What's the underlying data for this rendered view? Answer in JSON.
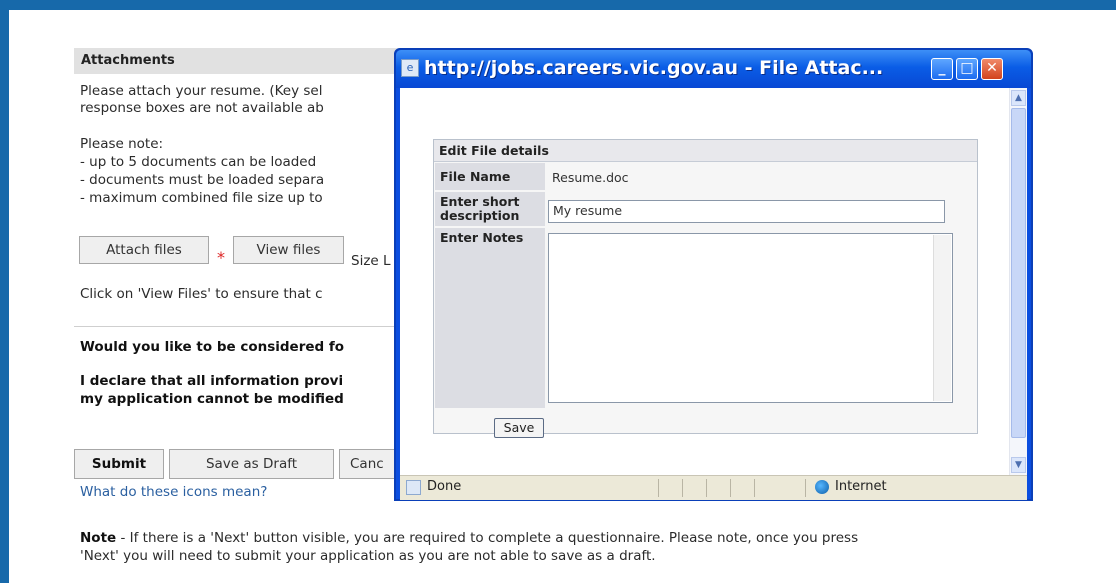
{
  "page": {
    "section_title": "Attachments",
    "intro_line1": "Please attach your resume. (Key sel",
    "intro_line2": "response boxes are not available ab",
    "note_heading": "Please note:",
    "note_item1": "- up to 5 documents can be loaded",
    "note_item2": "- documents must be loaded separa",
    "note_item3": "- maximum combined file size up to",
    "attach_btn": "Attach files",
    "required_star": "*",
    "view_btn": "View files",
    "size_text": "Size L",
    "click_line": "Click on 'View Files' to ensure that c",
    "consider_q": "Would you like to be considered fo",
    "declare_line1": "I declare that all information provi",
    "declare_line2": "my application cannot be modified",
    "submit_btn": "Submit",
    "save_draft_btn": "Save as Draft",
    "cancel_btn": "Canc",
    "icons_link": "What do these icons mean?",
    "footer_note_bold": "Note",
    "footer_note_line1": " - If there is a 'Next' button visible, you are required to complete a questionnaire. Please note, once you press",
    "footer_note_line2": "'Next' you will need to submit your application as you are not able to save as a draft."
  },
  "popup": {
    "title": "http://jobs.careers.vic.gov.au - File Attac...",
    "panel_title": "Edit File details",
    "file_name_label": "File Name",
    "file_name_value": "Resume.doc",
    "short_desc_label_line1": "Enter short",
    "short_desc_label_line2": "description",
    "short_desc_value": "My resume",
    "notes_label": "Enter Notes",
    "notes_value": "",
    "save_btn": "Save",
    "status_done": "Done",
    "status_zone": "Internet"
  },
  "icons": {
    "title_icon": "ie-page-icon",
    "minimize": "minimize-icon",
    "maximize": "maximize-icon",
    "close": "close-icon",
    "status_page": "page-icon",
    "status_zone": "globe-icon"
  },
  "colors": {
    "frame_blue": "#1769aa",
    "titlebar_blue": "#0a5de6",
    "required_red": "#dd2222",
    "link_blue": "#2a5fa0"
  }
}
